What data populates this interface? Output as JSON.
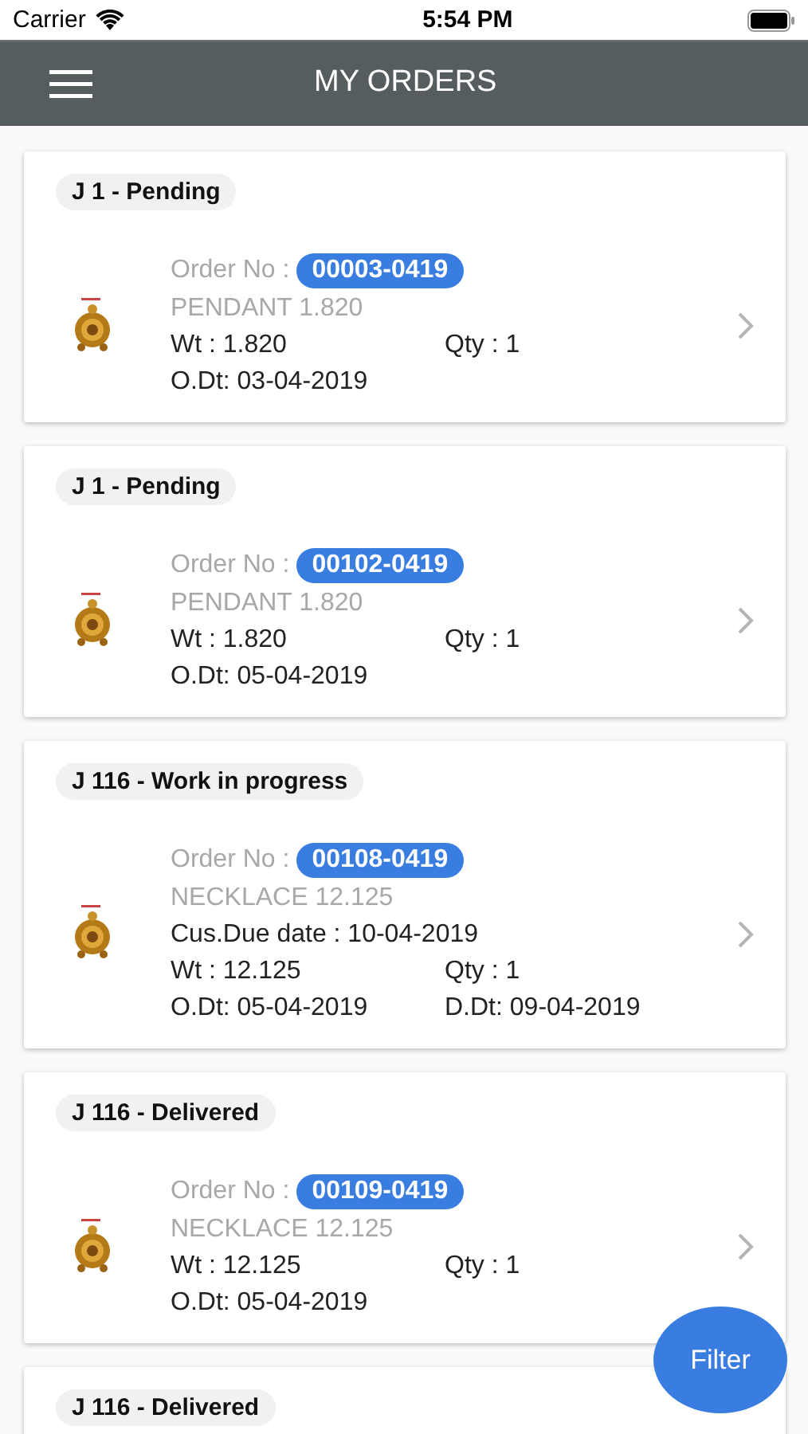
{
  "status_bar": {
    "carrier": "Carrier",
    "time": "5:54 PM"
  },
  "nav": {
    "title": "MY ORDERS"
  },
  "orders": [
    {
      "status": "J 1 - Pending",
      "order_label": "Order No :",
      "order_no": "00003-0419",
      "product": "PENDANT 1.820",
      "weight": "Wt : 1.820",
      "qty": "Qty : 1",
      "order_date": "O.Dt: 03-04-2019"
    },
    {
      "status": "J 1 - Pending",
      "order_label": "Order No :",
      "order_no": "00102-0419",
      "product": "PENDANT 1.820",
      "weight": "Wt : 1.820",
      "qty": "Qty : 1",
      "order_date": "O.Dt: 05-04-2019"
    },
    {
      "status": "J 116 - Work in progress",
      "order_label": "Order No :",
      "order_no": "00108-0419",
      "product": "NECKLACE 12.125",
      "due_date": "Cus.Due date : 10-04-2019",
      "weight": "Wt : 12.125",
      "qty": "Qty : 1",
      "order_date": "O.Dt: 05-04-2019",
      "delivery_date": "D.Dt: 09-04-2019"
    },
    {
      "status": "J 116 - Delivered",
      "order_label": "Order No :",
      "order_no": "00109-0419",
      "product": "NECKLACE 12.125",
      "weight": "Wt : 12.125",
      "qty": "Qty : 1",
      "order_date": "O.Dt: 05-04-2019"
    },
    {
      "status": "J 116 - Delivered"
    }
  ],
  "filter_button": "Filter"
}
